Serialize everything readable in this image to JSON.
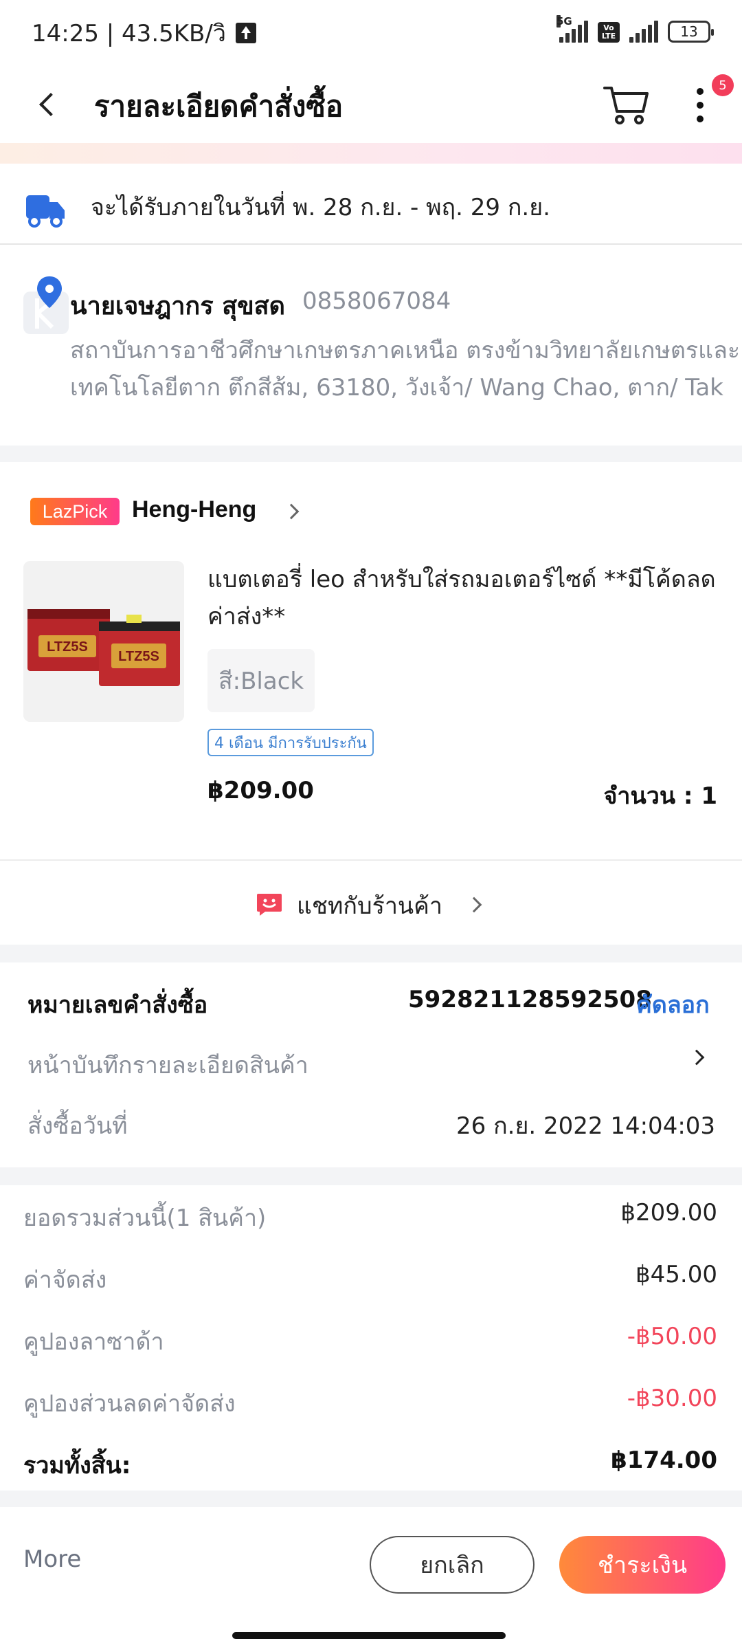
{
  "status_bar": {
    "time_speed": "14:25 | 43.5KB/วิ",
    "network": "5G",
    "volte": "Vo LTE",
    "battery": "13"
  },
  "header": {
    "title": "รายละเอียดคำสั่งซื้อ",
    "cart_badge": "5"
  },
  "delivery": {
    "text": "จะได้รับภายในวันที่ พ. 28 ก.ย. - พฤ. 29 ก.ย."
  },
  "address": {
    "name": "นายเจษฎากร สุขสด",
    "phone": "0858067084",
    "line1": "สถาบันการอาชีวศึกษาเกษตรภาคเหนือ ตรงข้ามวิทยาลัยเกษตรและ",
    "line2": "เทคโนโลยีตาก ตึกสีส้ม, 63180, วังเจ้า/ Wang Chao, ตาก/ Tak"
  },
  "store": {
    "badge": "LazPick",
    "name": "Heng-Heng"
  },
  "product": {
    "title": "แบตเตอรี่ leo สำหรับใส่รถมอเตอร์ไซด์ **มีโค้ดลดค่าส่ง**",
    "image_label": "LTZ5S",
    "variant": "สี:Black",
    "warranty": "4 เดือน มีการรับประกัน",
    "price": "฿209.00",
    "quantity": "จำนวน : 1"
  },
  "chat": {
    "label": "แชทกับร้านค้า"
  },
  "order_info": {
    "order_no_label": "หมายเลขคำสั่งซื้อ",
    "order_no": "592821128592508",
    "copy_label": "คัดลอก",
    "detail_label": "หน้าบันทึกรายละเอียดสินค้า",
    "date_label": "สั่งซื้อวันที่",
    "date_value": "26 ก.ย. 2022  14:04:03"
  },
  "summary": {
    "rows": [
      {
        "label": "ยอดรวมส่วนนี้(1 สินค้า)",
        "value": "฿209.00"
      },
      {
        "label": "ค่าจัดส่ง",
        "value": "฿45.00"
      },
      {
        "label": "คูปองลาซาด้า",
        "value": "-฿50.00"
      },
      {
        "label": "คูปองส่วนลดค่าจัดส่ง",
        "value": "-฿30.00"
      }
    ],
    "total_label": "รวมทั้งสิ้น:",
    "total_value": "฿174.00"
  },
  "bottom_bar": {
    "more": "More",
    "cancel": "ยกเลิก",
    "pay": "ชำระเงิน"
  },
  "colors": {
    "accent_blue": "#2a6fd6",
    "discount_red": "#f2455a",
    "badge_red": "#f23d5a",
    "pay_gradient_start": "#ff8a3a",
    "pay_gradient_end": "#ff3b8a"
  }
}
